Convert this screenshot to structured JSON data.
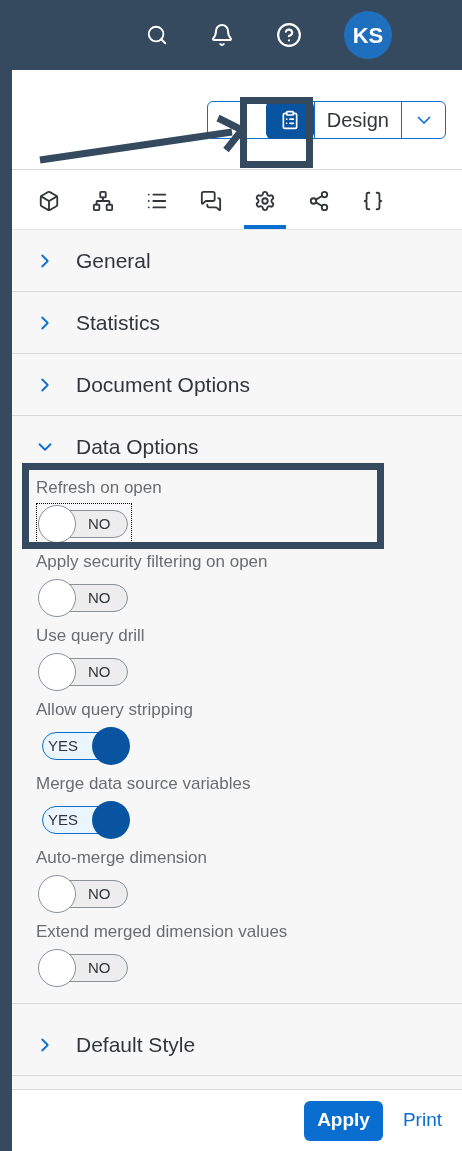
{
  "header": {
    "avatar": "KS"
  },
  "toolbar": {
    "mode_button": "Design",
    "clipboard_selected": true
  },
  "tabs": [
    {
      "selected": false
    },
    {
      "selected": false
    },
    {
      "selected": false
    },
    {
      "selected": false
    },
    {
      "selected": true
    },
    {
      "selected": false
    },
    {
      "selected": false
    }
  ],
  "sections": [
    {
      "title": "General",
      "expanded": false
    },
    {
      "title": "Statistics",
      "expanded": false
    },
    {
      "title": "Document Options",
      "expanded": false
    },
    {
      "title": "Data Options",
      "expanded": true,
      "options": [
        {
          "label": "Refresh on open",
          "on": false,
          "state_text": "NO",
          "focused": true
        },
        {
          "label": "Apply security filtering on open",
          "on": false,
          "state_text": "NO",
          "focused": false
        },
        {
          "label": "Use query drill",
          "on": false,
          "state_text": "NO",
          "focused": false
        },
        {
          "label": "Allow query stripping",
          "on": true,
          "state_text": "YES",
          "focused": false
        },
        {
          "label": "Merge data source variables",
          "on": true,
          "state_text": "YES",
          "focused": false
        },
        {
          "label": "Auto-merge dimension",
          "on": false,
          "state_text": "NO",
          "focused": false
        },
        {
          "label": "Extend merged dimension values",
          "on": false,
          "state_text": "NO",
          "focused": false
        }
      ]
    },
    {
      "title": "Default Style",
      "expanded": false
    }
  ],
  "footer": {
    "buttons": [
      "Apply",
      "Print"
    ]
  }
}
